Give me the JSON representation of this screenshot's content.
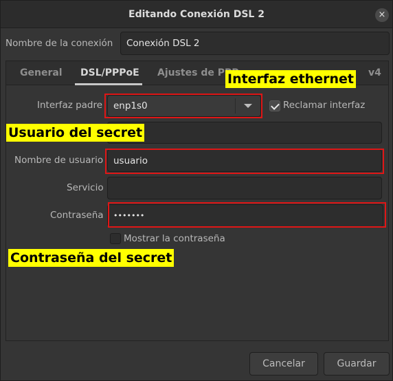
{
  "window": {
    "title": "Editando Conexión DSL 2",
    "close_icon": "×"
  },
  "connection_name": {
    "label": "Nombre de la conexión",
    "value": "Conexión DSL 2"
  },
  "tabs": [
    {
      "label": "General",
      "active": false
    },
    {
      "label": "DSL/PPPoE",
      "active": true
    },
    {
      "label": "Ajustes de PPP",
      "active": false
    },
    {
      "label": "v4",
      "active": false
    }
  ],
  "dsl": {
    "parent_interface": {
      "label": "Interfaz padre",
      "value": "enp1s0"
    },
    "claim_interface": {
      "label": "Reclamar interfaz",
      "checked": true
    },
    "username": {
      "label": "Nombre de usuario",
      "value": "usuario"
    },
    "service": {
      "label": "Servicio",
      "value": ""
    },
    "password": {
      "label": "Contraseña",
      "value": "•••••••"
    },
    "show_password": {
      "label": "Mostrar la contraseña",
      "checked": false
    }
  },
  "annotations": {
    "ethernet": "Interfaz ethernet",
    "user_secret": "Usuario del secret",
    "password_secret": "Contraseña del secret"
  },
  "buttons": {
    "cancel": "Cancelar",
    "save": "Guardar"
  },
  "colors": {
    "highlight": "#e01616",
    "note_bg": "#ffff00"
  }
}
